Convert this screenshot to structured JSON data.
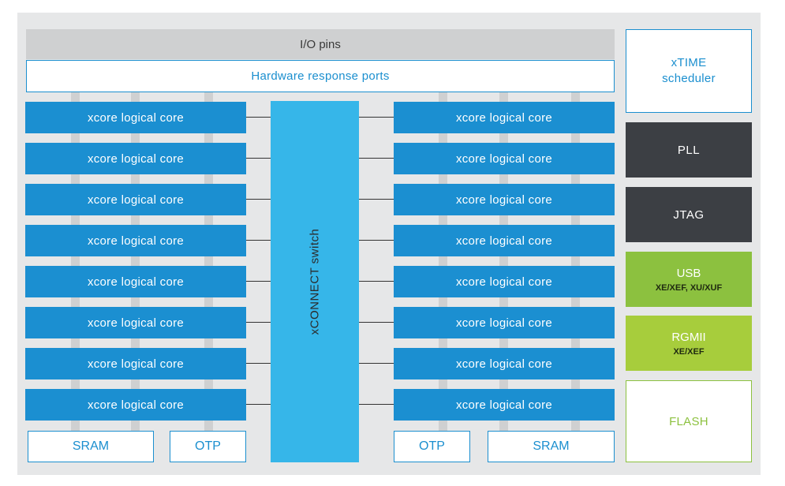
{
  "io_pins": "I/O pins",
  "hardware_response_ports": "Hardware response ports",
  "xconnect_switch": "xCONNECT switch",
  "left_cores": [
    "xcore logical core",
    "xcore logical core",
    "xcore logical core",
    "xcore logical core",
    "xcore logical core",
    "xcore logical core",
    "xcore logical core",
    "xcore logical core"
  ],
  "right_cores": [
    "xcore logical core",
    "xcore logical core",
    "xcore logical core",
    "xcore logical core",
    "xcore logical core",
    "xcore logical core",
    "xcore logical core",
    "xcore logical core"
  ],
  "left_memory": {
    "sram": "SRAM",
    "otp": "OTP"
  },
  "right_memory": {
    "otp": "OTP",
    "sram": "SRAM"
  },
  "side_blocks": {
    "xtime_line1": "xTIME",
    "xtime_line2": "scheduler",
    "pll": "PLL",
    "jtag": "JTAG",
    "usb": "USB",
    "usb_variants": "XE/XEF, XU/XUF",
    "rgmii": "RGMII",
    "rgmii_variants": "XE/XEF",
    "flash": "FLASH"
  },
  "colors": {
    "core_blue": "#1b8fd1",
    "switch_blue": "#36b6e9",
    "dark_block": "#3c3f44",
    "usb_green": "#8cc13f",
    "rgmii_green": "#a7cd3c",
    "background_gray": "#e6e7e8"
  }
}
